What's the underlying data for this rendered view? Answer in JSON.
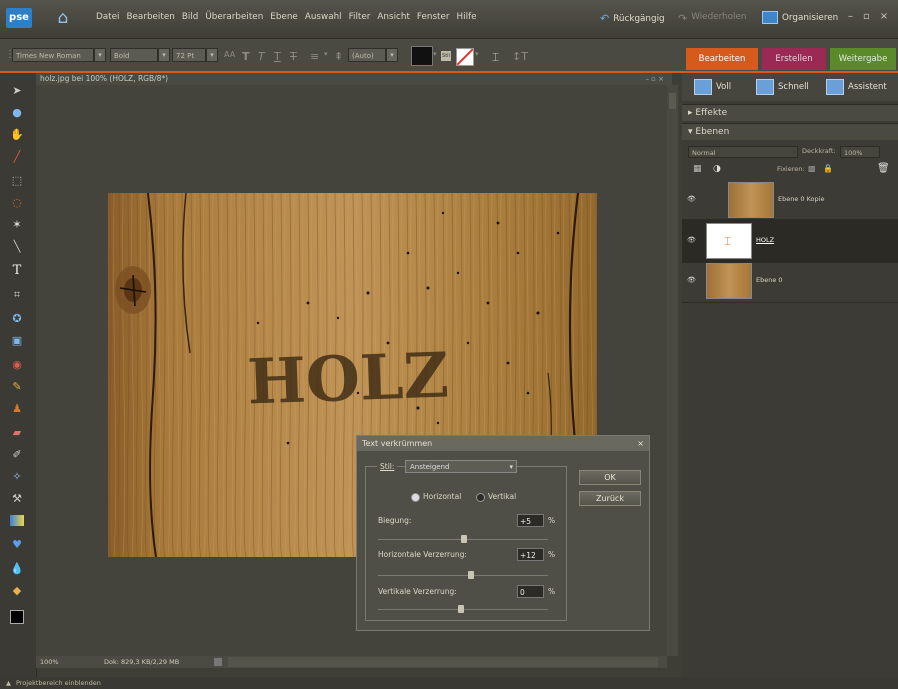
{
  "menubar": {
    "logo": "pse",
    "menus": [
      "Datei",
      "Bearbeiten",
      "Bild",
      "Überarbeiten",
      "Ebene",
      "Auswahl",
      "Filter",
      "Ansicht",
      "Fenster",
      "Hilfe"
    ],
    "undo": "Rückgängig",
    "redo": "Wiederholen",
    "organize": "Organisieren",
    "window_buttons": [
      "–",
      "▫",
      "×"
    ]
  },
  "options": {
    "font": "Times New Roman",
    "style": "Bold",
    "size": "72 Pt",
    "leading": "(Auto)",
    "warp_glyph": "⌶",
    "aa": "AA"
  },
  "mode_tabs": [
    "Bearbeiten",
    "Erstellen",
    "Weitergabe"
  ],
  "colors": {
    "accent": "#d65a1c",
    "erstellen": "#9a2a55",
    "weitergabe": "#5a8a2a",
    "selected_layer": "#2b2a25"
  },
  "document": {
    "title": "holz.jpg bei 100% (HOLZ, RGB/8*)",
    "zoom": "100%",
    "doc_size": "Dok: 829,3 KB/2,29 MB",
    "canvas_text": "HOLZ"
  },
  "bottom": {
    "project_bin": "Projektbereich einblenden"
  },
  "dialog": {
    "title": "Text verkrümmen",
    "style_label": "Stil:",
    "style_value": "Ansteigend",
    "horizontal": "Horizontal",
    "vertical": "Vertikal",
    "bend_label": "Biegung:",
    "bend_value": "+5",
    "hdist_label": "Horizontale Verzerrung:",
    "hdist_value": "+12",
    "vdist_label": "Vertikale Verzerrung:",
    "vdist_value": "0",
    "percent": "%",
    "ok": "OK",
    "back": "Zurück",
    "close": "×"
  },
  "rpanel": {
    "tabs": [
      "Voll",
      "Schnell",
      "Assistent"
    ],
    "effects": "Effekte",
    "layers": "Ebenen",
    "blend_mode": "Normal",
    "opacity_label": "Deckkraft:",
    "opacity_value": "100%",
    "fix_label": "Fixieren:",
    "layer_items": [
      {
        "name": "Ebene 0 Kopie"
      },
      {
        "name": "HOLZ"
      },
      {
        "name": "Ebene 0"
      }
    ]
  }
}
